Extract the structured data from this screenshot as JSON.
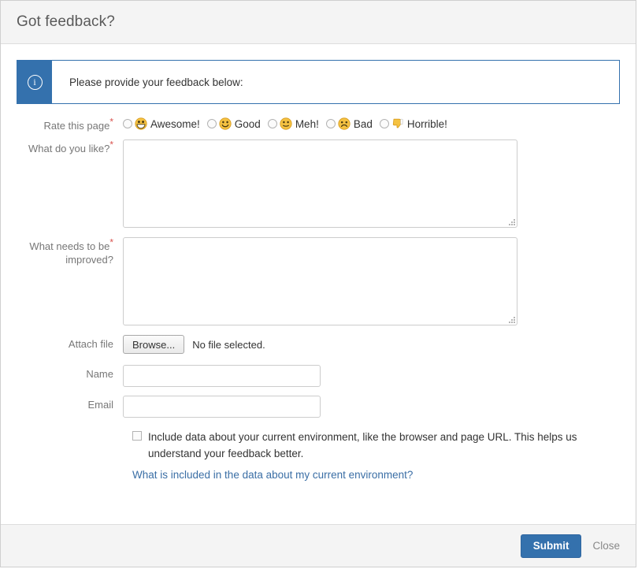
{
  "header": {
    "title": "Got feedback?"
  },
  "banner": {
    "icon": "info-circle-icon",
    "message": "Please provide your feedback below:"
  },
  "form": {
    "rating": {
      "label": "Rate this page",
      "required": "*",
      "options": [
        {
          "emoji": "grinning-face-icon",
          "label": "Awesome!"
        },
        {
          "emoji": "smiling-face-icon",
          "label": "Good"
        },
        {
          "emoji": "neutral-face-icon",
          "label": "Meh!"
        },
        {
          "emoji": "frowning-face-icon",
          "label": "Bad"
        },
        {
          "emoji": "thumbs-down-icon",
          "label": "Horrible!"
        }
      ]
    },
    "like": {
      "label": "What do you like?",
      "required": "*",
      "value": "",
      "placeholder": ""
    },
    "improve": {
      "label_line1": "What needs to be",
      "label_line2": "improved?",
      "required": "*",
      "value": "",
      "placeholder": ""
    },
    "attach": {
      "label": "Attach file",
      "button_label": "Browse...",
      "status": "No file selected."
    },
    "name": {
      "label": "Name",
      "value": "",
      "placeholder": ""
    },
    "email": {
      "label": "Email",
      "value": "",
      "placeholder": ""
    },
    "consent": {
      "text": "Include data about your current environment, like the browser and page URL. This helps us understand your feedback better.",
      "link": "What is included in the data about my current environment?",
      "checked": false
    }
  },
  "footer": {
    "submit_label": "Submit",
    "close_label": "Close"
  },
  "colors": {
    "accent": "#3471ad",
    "link": "#3a6ea5",
    "required": "#d9534f",
    "header_bg": "#f4f4f4",
    "emoji_yellow": "#f5c242"
  }
}
